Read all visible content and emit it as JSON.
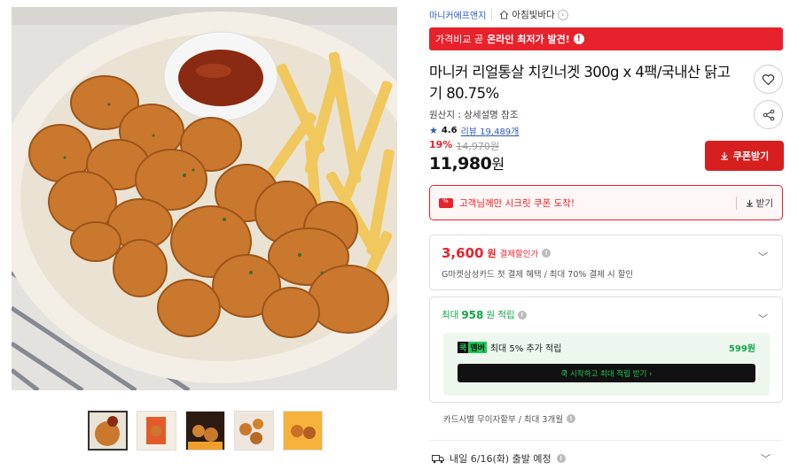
{
  "seller": {
    "name": "마니커에프앤지",
    "store_icon": "home-icon",
    "store_name": "아침빛바다"
  },
  "price_banner": {
    "prefix": "가격비교 곧",
    "highlight": "온라인 최저가 발견!",
    "info": "!"
  },
  "product": {
    "title": "마니커 리얼통살 치킨너겟 300g x 4팩/국내산 닭고기 80.75%",
    "origin": "원산지 : 상세설명 참조",
    "rating": "4.6",
    "reviews": "리뷰 19,489개",
    "discount_rate": "19%",
    "original_price": "14,970원",
    "sale_price": "11,980",
    "sale_unit": "원"
  },
  "buttons": {
    "coupon": "쿠폰받기",
    "like_icon": "heart-icon",
    "share_icon": "share-icon"
  },
  "secret_coupon": {
    "text": "고객님께만 시크릿 쿠폰 도착!",
    "receive": "받기"
  },
  "card_offer": {
    "price": "3,600",
    "unit": "원",
    "tag": "결제할인가",
    "description": "G마켓삼성카드 첫 결제 혜택 / 최대 70% 결제 시 할인"
  },
  "points": {
    "prefix": "최대",
    "amount": "958",
    "suffix": "원 적립",
    "member_k": "쿡",
    "member_m": "멤버",
    "member_text": "최대 5% 추가 적립",
    "member_points": "599원",
    "cta": "쿡 시작하고 최대 적립 받기 ›"
  },
  "installment": "카드사별 무이자할부 / 최대 3개월",
  "shipping": "내일 6/16(화) 출발 예정",
  "colors": {
    "accent_red": "#e8222c",
    "green": "#13a54b",
    "link_blue": "#2c5ab8"
  }
}
